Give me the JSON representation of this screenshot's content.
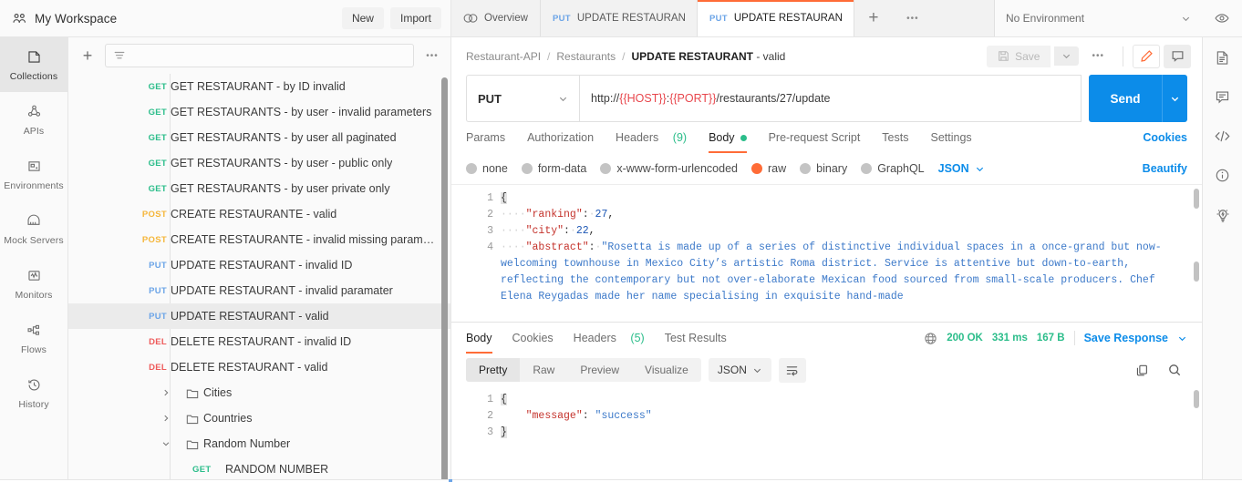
{
  "workspace": {
    "icon": "people-icon",
    "name": "My Workspace",
    "new_label": "New",
    "import_label": "Import"
  },
  "tabs": {
    "overview_label": "Overview",
    "items": [
      {
        "method": "PUT",
        "label": "UPDATE RESTAURANT - i",
        "active": false
      },
      {
        "method": "PUT",
        "label": "UPDATE RESTAURANT - v",
        "active": true
      }
    ],
    "plus_label": "+",
    "ellipsis_label": "•••"
  },
  "environment": {
    "selected": "No Environment",
    "eye_icon": "eye-icon"
  },
  "rail": {
    "items": [
      {
        "label": "Collections",
        "icon": "collections-icon",
        "active": true
      },
      {
        "label": "APIs",
        "icon": "apis-icon",
        "active": false
      },
      {
        "label": "Environments",
        "icon": "environments-icon",
        "active": false
      },
      {
        "label": "Mock Servers",
        "icon": "mock-servers-icon",
        "active": false
      },
      {
        "label": "Monitors",
        "icon": "monitors-icon",
        "active": false
      },
      {
        "label": "Flows",
        "icon": "flows-icon",
        "active": false
      },
      {
        "label": "History",
        "icon": "history-icon",
        "active": false
      }
    ]
  },
  "sidebar": {
    "add_label": "+",
    "filter_placeholder": "",
    "filter_value": "",
    "filter_icon": "filter-icon",
    "ellipsis_label": "•••",
    "rows": [
      {
        "kind": "request",
        "method": "GET",
        "name": "GET RESTAURANT - by ID invalid",
        "selected": false
      },
      {
        "kind": "request",
        "method": "GET",
        "name": "GET RESTAURANTS - by user - invalid parameters",
        "selected": false
      },
      {
        "kind": "request",
        "method": "GET",
        "name": "GET RESTAURANTS - by user all paginated",
        "selected": false
      },
      {
        "kind": "request",
        "method": "GET",
        "name": "GET RESTAURANTS - by user - public only",
        "selected": false
      },
      {
        "kind": "request",
        "method": "GET",
        "name": "GET RESTAURANTS - by user private only",
        "selected": false
      },
      {
        "kind": "request",
        "method": "POST",
        "name": "CREATE RESTAURANTE - valid",
        "selected": false
      },
      {
        "kind": "request",
        "method": "POST",
        "name": "CREATE RESTAURANTE - invalid missing parame…",
        "selected": false
      },
      {
        "kind": "request",
        "method": "PUT",
        "name": "UPDATE RESTAURANT - invalid ID",
        "selected": false
      },
      {
        "kind": "request",
        "method": "PUT",
        "name": "UPDATE RESTAURANT - invalid paramater",
        "selected": false
      },
      {
        "kind": "request",
        "method": "PUT",
        "name": "UPDATE RESTAURANT - valid",
        "selected": true
      },
      {
        "kind": "request",
        "method": "DEL",
        "name": "DELETE RESTAURANT - invalid ID",
        "selected": false
      },
      {
        "kind": "request",
        "method": "DEL",
        "name": "DELETE RESTAURANT - valid",
        "selected": false
      },
      {
        "kind": "folder",
        "name": "Cities",
        "expanded": false
      },
      {
        "kind": "folder",
        "name": "Countries",
        "expanded": false
      },
      {
        "kind": "folder",
        "name": "Random Number",
        "expanded": true
      },
      {
        "kind": "request-in-folder",
        "method": "GET",
        "name": "RANDOM NUMBER",
        "selected": false
      }
    ]
  },
  "request": {
    "breadcrumb": [
      {
        "label": "Restaurant-API",
        "current": false
      },
      {
        "label": "Restaurants",
        "current": false
      }
    ],
    "breadcrumb_separator": "/",
    "title_main": "UPDATE RESTAURANT",
    "title_suffix": " - valid",
    "save_label": "Save",
    "save_icon": "save-icon",
    "save_caret_icon": "chevron-down-icon",
    "header_ellipsis": "•••",
    "edit_icon": "pencil-icon",
    "comment_icon": "comment-icon",
    "method": "PUT",
    "url_prefix": "http://",
    "url_var_host": "{{HOST}}",
    "url_colon": ":",
    "url_var_port": "{{PORT}}",
    "url_suffix": "/restaurants/27/update",
    "send_label": "Send",
    "tabs": [
      {
        "label": "Params",
        "active": false,
        "count": ""
      },
      {
        "label": "Authorization",
        "active": false,
        "count": ""
      },
      {
        "label": "Headers",
        "active": false,
        "count": "(9)"
      },
      {
        "label": "Body",
        "active": true,
        "count": "",
        "dot": true
      },
      {
        "label": "Pre-request Script",
        "active": false,
        "count": ""
      },
      {
        "label": "Tests",
        "active": false,
        "count": ""
      },
      {
        "label": "Settings",
        "active": false,
        "count": ""
      }
    ],
    "cookies_label": "Cookies",
    "body_modes": [
      {
        "label": "none",
        "selected": false
      },
      {
        "label": "form-data",
        "selected": false
      },
      {
        "label": "x-www-form-urlencoded",
        "selected": false
      },
      {
        "label": "raw",
        "selected": true
      },
      {
        "label": "binary",
        "selected": false
      },
      {
        "label": "GraphQL",
        "selected": false
      }
    ],
    "body_format": "JSON",
    "beautify_label": "Beautify",
    "body_lines": [
      "1",
      "2",
      "3",
      "4"
    ],
    "body_code": {
      "open_brace": "{",
      "line2_key": "\"ranking\"",
      "line2_val": "27",
      "line3_key": "\"city\"",
      "line3_val": "22",
      "line4_key": "\"abstract\"",
      "line4_val": "\"Rosetta is made up of a series of distinctive individual spaces in a once-grand but now-welcoming townhouse in Mexico City’s artistic Roma district. Service is attentive but down-to-earth, reflecting the contemporary but not over-elaborate Mexican food sourced from small-scale producers. Chef Elena Reygadas made her name specialising in exquisite hand-made"
    }
  },
  "response": {
    "tabs": [
      {
        "label": "Body",
        "active": true,
        "count": ""
      },
      {
        "label": "Cookies",
        "active": false,
        "count": ""
      },
      {
        "label": "Headers",
        "active": false,
        "count": "(5)"
      },
      {
        "label": "Test Results",
        "active": false,
        "count": ""
      }
    ],
    "globe_icon": "globe-icon",
    "status": "200 OK",
    "time": "331 ms",
    "size": "167 B",
    "save_response_label": "Save Response",
    "view_modes": [
      {
        "label": "Pretty",
        "active": true
      },
      {
        "label": "Raw",
        "active": false
      },
      {
        "label": "Preview",
        "active": false
      },
      {
        "label": "Visualize",
        "active": false
      }
    ],
    "format": "JSON",
    "wrap_icon": "wrap-lines-icon",
    "copy_icon": "copy-icon",
    "search_icon": "search-icon",
    "lines": [
      "1",
      "2",
      "3"
    ],
    "code": {
      "open_brace": "{",
      "key": "\"message\"",
      "value": "\"success\"",
      "close_brace": "}"
    }
  },
  "right_rail": {
    "items": [
      {
        "icon": "documentation-icon"
      },
      {
        "icon": "comment-icon"
      },
      {
        "icon": "code-icon"
      },
      {
        "icon": "info-icon"
      },
      {
        "icon": "lightbulb-icon"
      }
    ]
  },
  "colors": {
    "accent": "#ff6c37",
    "send": "#0c8ce9",
    "get": "#2bbd8a",
    "post": "#f5b63a",
    "put": "#6ba4e7",
    "del": "#ee5a5a",
    "success": "#2bbd8a"
  }
}
